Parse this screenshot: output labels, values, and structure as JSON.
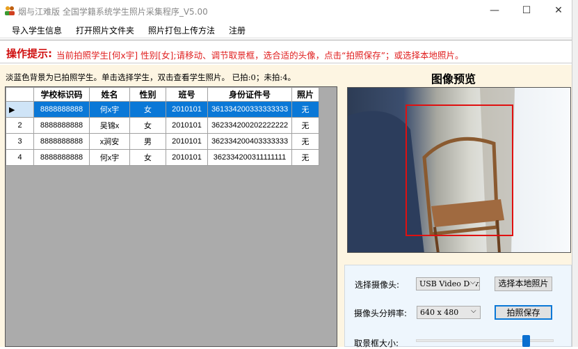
{
  "window": {
    "title": "烟与江难版 全国学籍系统学生照片采集程序_V5.00",
    "minimize": "—",
    "maximize": "☐",
    "close": "✕"
  },
  "menu": [
    "导入学生信息",
    "打开照片文件夹",
    "照片打包上传方法",
    "注册"
  ],
  "prompt": {
    "label": "操作提示:",
    "text": "当前拍照学生[何x宇] 性别[女];请移动、调节取景框，选合适的头像，点击“拍照保存”；或选择本地照片。"
  },
  "info": "淡蓝色背景为已拍照学生。单击选择学生，双击查看学生照片。 已拍:0；未拍:4。",
  "table": {
    "headers": [
      "学校标识码",
      "姓名",
      "性别",
      "班号",
      "身份证件号",
      "照片"
    ],
    "rows": [
      {
        "rh": "▶",
        "cells": [
          "8888888888",
          "何x宇",
          "女",
          "2010101",
          "361334200333333333",
          "无"
        ]
      },
      {
        "rh": "2",
        "cells": [
          "8888888888",
          "吴锦x",
          "女",
          "2010101",
          "362334200202222222",
          "无"
        ]
      },
      {
        "rh": "3",
        "cells": [
          "8888888888",
          "x涧安",
          "男",
          "2010101",
          "362334200403333333",
          "无"
        ]
      },
      {
        "rh": "4",
        "cells": [
          "8888888888",
          "何x宇",
          "女",
          "2010101",
          "362334200311111111",
          "无"
        ]
      }
    ]
  },
  "preview": {
    "title": "图像预览"
  },
  "controls": {
    "camera_label": "选择摄像头:",
    "camera_value": "USB Video Device",
    "resolution_label": "摄像头分辨率:",
    "resolution_value": "640 x 480",
    "local_photo_btn": "选择本地照片",
    "save_btn": "拍照保存",
    "frame_size_label": "取景框大小:",
    "frame_size_value": 0.8
  }
}
